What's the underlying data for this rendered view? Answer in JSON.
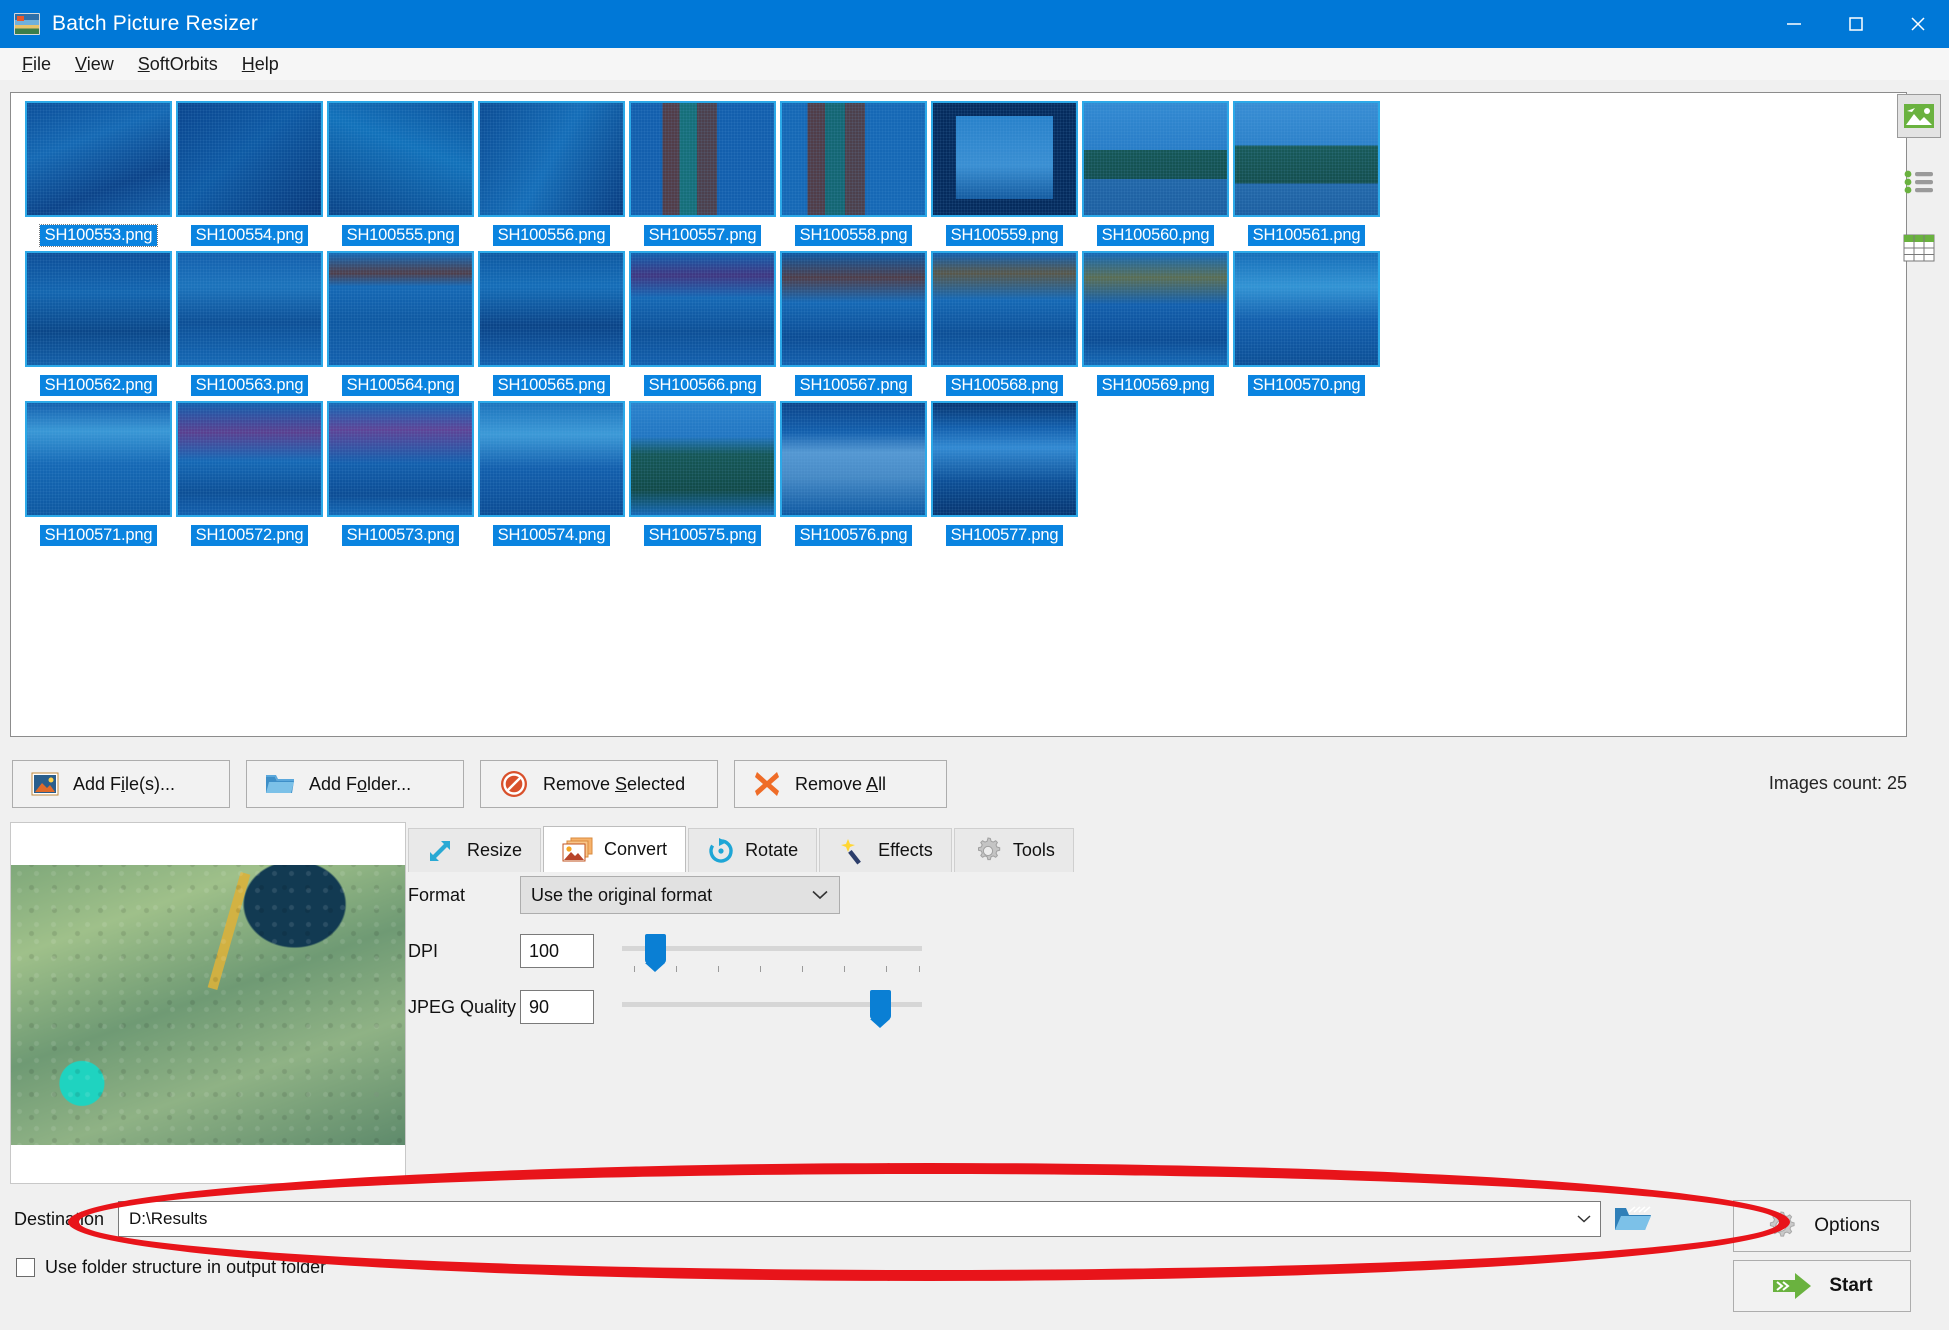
{
  "window": {
    "title": "Batch Picture Resizer",
    "icon": "app-icon",
    "controls": {
      "minimize": "minimize-icon",
      "maximize": "maximize-icon",
      "close": "close-icon"
    }
  },
  "menu": {
    "items": [
      "File",
      "View",
      "SoftOrbits",
      "Help"
    ]
  },
  "thumbnails": {
    "rows": [
      [
        {
          "name": "SH100553.png",
          "art": "a-reef1"
        },
        {
          "name": "SH100554.png",
          "art": "a-reef2"
        },
        {
          "name": "SH100555.png",
          "art": "a-reef3"
        },
        {
          "name": "SH100556.png",
          "art": "a-reef4"
        },
        {
          "name": "SH100557.png",
          "art": "a-pillar"
        },
        {
          "name": "SH100558.png",
          "art": "a-pillar2"
        },
        {
          "name": "SH100559.png",
          "art": "a-window"
        },
        {
          "name": "SH100560.png",
          "art": "a-park"
        },
        {
          "name": "SH100561.png",
          "art": "a-park2"
        }
      ],
      [
        {
          "name": "SH100562.png",
          "art": "a-person"
        },
        {
          "name": "SH100563.png",
          "art": "a-arch"
        },
        {
          "name": "SH100564.png",
          "art": "a-court"
        },
        {
          "name": "SH100565.png",
          "art": "a-table"
        },
        {
          "name": "SH100566.png",
          "art": "a-table2"
        },
        {
          "name": "SH100567.png",
          "art": "a-table3"
        },
        {
          "name": "SH100568.png",
          "art": "a-table4"
        },
        {
          "name": "SH100569.png",
          "art": "a-table5"
        },
        {
          "name": "SH100570.png",
          "art": "a-food"
        }
      ],
      [
        {
          "name": "SH100571.png",
          "art": "a-food2"
        },
        {
          "name": "SH100572.png",
          "art": "a-pink"
        },
        {
          "name": "SH100573.png",
          "art": "a-pink2"
        },
        {
          "name": "SH100574.png",
          "art": "a-food3"
        },
        {
          "name": "SH100575.png",
          "art": "a-garden"
        },
        {
          "name": "SH100576.png",
          "art": "a-room"
        },
        {
          "name": "SH100577.png",
          "art": "a-room2"
        }
      ]
    ]
  },
  "view_modes": [
    {
      "name": "thumbnail-view-icon",
      "active": true
    },
    {
      "name": "list-view-icon",
      "active": false
    },
    {
      "name": "details-view-icon",
      "active": false
    }
  ],
  "actions": {
    "add_files": "Add File(s)...",
    "add_folder": "Add Folder...",
    "remove_selected": "Remove Selected",
    "remove_all": "Remove All",
    "images_count": "Images count: 25"
  },
  "tabs": [
    {
      "label": "Resize",
      "icon": "resize-arrows-icon",
      "active": false
    },
    {
      "label": "Convert",
      "icon": "convert-images-icon",
      "active": true
    },
    {
      "label": "Rotate",
      "icon": "rotate-icon",
      "active": false
    },
    {
      "label": "Effects",
      "icon": "magic-wand-icon",
      "active": false
    },
    {
      "label": "Tools",
      "icon": "gear-icon",
      "active": false
    }
  ],
  "convert": {
    "format_label": "Format",
    "format_value": "Use the original format",
    "dpi_label": "DPI",
    "dpi_value": "100",
    "dpi_percent": 11,
    "jpeg_label": "JPEG Quality",
    "jpeg_value": "90",
    "jpeg_percent": 86
  },
  "destination": {
    "label": "Destination",
    "value": "D:\\Results",
    "browse_icon": "folder-browse-icon",
    "use_folder_structure": "Use folder structure in output folder",
    "checked": false
  },
  "footer": {
    "options": "Options",
    "start": "Start"
  },
  "colors": {
    "titlebar": "#0078d7",
    "selection": "#0a84e0",
    "annotation": "#e8141a",
    "accent_green": "#6ab23f"
  }
}
